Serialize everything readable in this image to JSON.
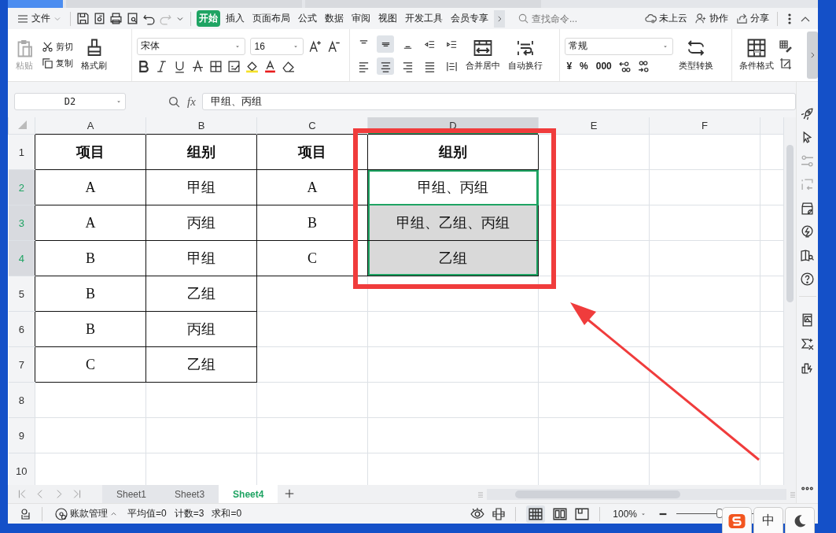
{
  "menu": {
    "file": "文件",
    "tabs": [
      {
        "label": "开始",
        "selected": true
      },
      {
        "label": "插入",
        "selected": false
      },
      {
        "label": "页面布局",
        "selected": false
      },
      {
        "label": "公式",
        "selected": false
      },
      {
        "label": "数据",
        "selected": false
      },
      {
        "label": "审阅",
        "selected": false
      },
      {
        "label": "视图",
        "selected": false
      },
      {
        "label": "开发工具",
        "selected": false
      },
      {
        "label": "会员专享",
        "selected": false
      }
    ],
    "search": {
      "placeholder": "查找命令..."
    },
    "actions": [
      {
        "kind": "cloud",
        "label": "未上云"
      },
      {
        "kind": "collab",
        "label": "协作"
      },
      {
        "kind": "share",
        "label": "分享"
      }
    ]
  },
  "ribbon": {
    "paste": {
      "label": "粘贴",
      "disabled": true
    },
    "cut": "剪切",
    "copy": "复制",
    "format_painter": "格式刷",
    "font_name": "宋体",
    "font_size": "16",
    "merge": "合并居中",
    "wrap": "自动换行",
    "number_format": "常规",
    "currency": "¥",
    "percent": "%",
    "thousands": "000",
    "convert": "类型转换",
    "conditional_format": "条件格式"
  },
  "formula_bar": {
    "cell": "D2",
    "fx": "fx",
    "value": "甲组、丙组"
  },
  "sheet": {
    "columns": [
      {
        "label": "A",
        "selected": false
      },
      {
        "label": "B",
        "selected": false
      },
      {
        "label": "C",
        "selected": false
      },
      {
        "label": "D",
        "selected": true
      },
      {
        "label": "E",
        "selected": false
      },
      {
        "label": "F",
        "selected": false
      }
    ],
    "rows": [
      {
        "label": "1",
        "selected": false,
        "bold": true,
        "cells": [
          {
            "text": "项目",
            "bordered": true,
            "selected": false,
            "active": false
          },
          {
            "text": "组别",
            "bordered": true,
            "selected": false,
            "active": false
          },
          {
            "text": "项目",
            "bordered": true,
            "selected": false,
            "active": false
          },
          {
            "text": "组别",
            "bordered": true,
            "selected": false,
            "active": false
          },
          {
            "bordered": false,
            "selected": false,
            "active": false
          },
          {
            "bordered": false,
            "selected": false,
            "active": false
          }
        ]
      },
      {
        "label": "2",
        "selected": true,
        "bold": false,
        "cells": [
          {
            "text": "A",
            "bordered": true,
            "selected": false,
            "active": false
          },
          {
            "text": "甲组",
            "bordered": true,
            "selected": false,
            "active": false
          },
          {
            "text": "A",
            "bordered": true,
            "selected": false,
            "active": false
          },
          {
            "text": "甲组、丙组",
            "bordered": true,
            "selected": true,
            "active": true
          },
          {
            "bordered": false,
            "selected": false,
            "active": false
          },
          {
            "bordered": false,
            "selected": false,
            "active": false
          }
        ]
      },
      {
        "label": "3",
        "selected": true,
        "bold": false,
        "cells": [
          {
            "text": "A",
            "bordered": true,
            "selected": false,
            "active": false
          },
          {
            "text": "丙组",
            "bordered": true,
            "selected": false,
            "active": false
          },
          {
            "text": "B",
            "bordered": true,
            "selected": false,
            "active": false
          },
          {
            "text": "甲组、乙组、丙组",
            "bordered": true,
            "selected": true,
            "active": false
          },
          {
            "bordered": false,
            "selected": false,
            "active": false
          },
          {
            "bordered": false,
            "selected": false,
            "active": false
          }
        ]
      },
      {
        "label": "4",
        "selected": true,
        "bold": false,
        "cells": [
          {
            "text": "B",
            "bordered": true,
            "selected": false,
            "active": false
          },
          {
            "text": "甲组",
            "bordered": true,
            "selected": false,
            "active": false
          },
          {
            "text": "C",
            "bordered": true,
            "selected": false,
            "active": false
          },
          {
            "text": "乙组",
            "bordered": true,
            "selected": true,
            "active": false
          },
          {
            "bordered": false,
            "selected": false,
            "active": false
          },
          {
            "bordered": false,
            "selected": false,
            "active": false
          }
        ]
      },
      {
        "label": "5",
        "selected": false,
        "bold": false,
        "cells": [
          {
            "text": "B",
            "bordered": true,
            "selected": false,
            "active": false
          },
          {
            "text": "乙组",
            "bordered": true,
            "selected": false,
            "active": false
          },
          {
            "bordered": false,
            "selected": false,
            "active": false
          },
          {
            "bordered": false,
            "selected": false,
            "active": false
          },
          {
            "bordered": false,
            "selected": false,
            "active": false
          },
          {
            "bordered": false,
            "selected": false,
            "active": false
          }
        ]
      },
      {
        "label": "6",
        "selected": false,
        "bold": false,
        "cells": [
          {
            "text": "B",
            "bordered": true,
            "selected": false,
            "active": false
          },
          {
            "text": "丙组",
            "bordered": true,
            "selected": false,
            "active": false
          },
          {
            "bordered": false,
            "selected": false,
            "active": false
          },
          {
            "bordered": false,
            "selected": false,
            "active": false
          },
          {
            "bordered": false,
            "selected": false,
            "active": false
          },
          {
            "bordered": false,
            "selected": false,
            "active": false
          }
        ]
      },
      {
        "label": "7",
        "selected": false,
        "bold": false,
        "cells": [
          {
            "text": "C",
            "bordered": true,
            "selected": false,
            "active": false
          },
          {
            "text": "乙组",
            "bordered": true,
            "selected": false,
            "active": false
          },
          {
            "bordered": false,
            "selected": false,
            "active": false
          },
          {
            "bordered": false,
            "selected": false,
            "active": false
          },
          {
            "bordered": false,
            "selected": false,
            "active": false
          },
          {
            "bordered": false,
            "selected": false,
            "active": false
          }
        ]
      },
      {
        "label": "8",
        "selected": false,
        "cells": [
          {
            "bordered": false,
            "selected": false,
            "active": false
          },
          {
            "bordered": false,
            "selected": false,
            "active": false
          },
          {
            "bordered": false,
            "selected": false,
            "active": false
          },
          {
            "bordered": false,
            "selected": false,
            "active": false
          },
          {
            "bordered": false,
            "selected": false,
            "active": false
          },
          {
            "bordered": false,
            "selected": false,
            "active": false
          }
        ]
      },
      {
        "label": "9",
        "selected": false,
        "cells": [
          {
            "bordered": false,
            "selected": false,
            "active": false
          },
          {
            "bordered": false,
            "selected": false,
            "active": false
          },
          {
            "bordered": false,
            "selected": false,
            "active": false
          },
          {
            "bordered": false,
            "selected": false,
            "active": false
          },
          {
            "bordered": false,
            "selected": false,
            "active": false
          },
          {
            "bordered": false,
            "selected": false,
            "active": false
          }
        ]
      },
      {
        "label": "10",
        "selected": false,
        "cells": [
          {
            "selected": false,
            "active": false
          },
          {
            "selected": false,
            "active": false
          },
          {
            "selected": false,
            "active": false
          },
          {
            "selected": false,
            "active": false
          },
          {
            "selected": false,
            "active": false
          },
          {
            "selected": false,
            "active": false
          }
        ]
      }
    ]
  },
  "sheet_tabs": [
    {
      "label": "Sheet1",
      "selected": false
    },
    {
      "label": "Sheet3",
      "selected": false
    },
    {
      "label": "Sheet4",
      "selected": true
    }
  ],
  "status_bar": {
    "account": "账款管理",
    "stats": [
      "平均值=0",
      "计数=3",
      "求和=0"
    ],
    "zoom": "100%",
    "zoom_slider": {
      "level": 0.5
    }
  },
  "ime": {
    "mode": "中"
  }
}
